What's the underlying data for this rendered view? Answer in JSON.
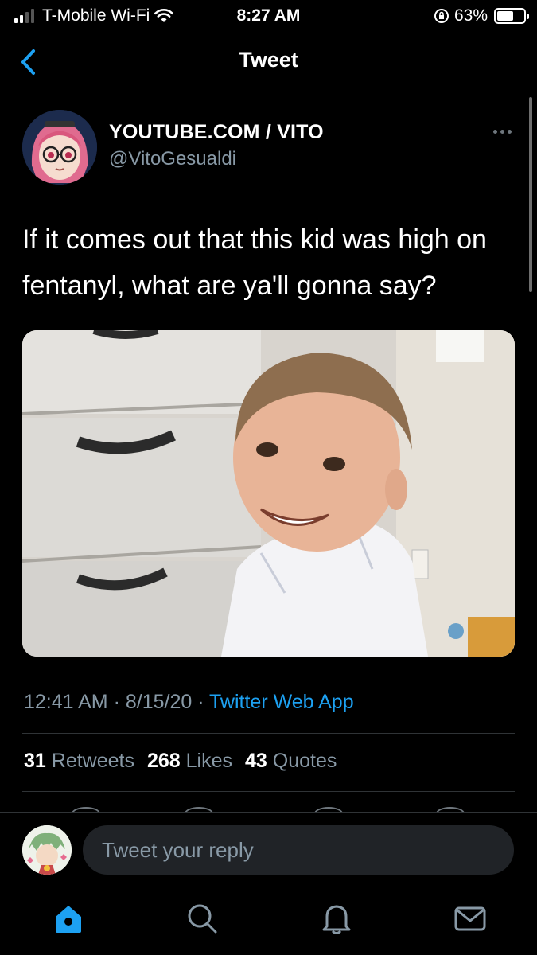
{
  "status_bar": {
    "carrier": "T-Mobile Wi-Fi",
    "time": "8:27 AM",
    "battery": "63%",
    "battery_level": 0.63
  },
  "nav": {
    "title": "Tweet",
    "back_icon": "chevron-left-icon"
  },
  "tweet": {
    "display_name": "YOUTUBE.COM / VITO",
    "handle": "@VitoGesualdi",
    "text": "If it comes out that this kid was high on fentanyl, what are ya'll gonna say?",
    "timestamp": "12:41 AM · 8/15/20 · ",
    "source": "Twitter Web App",
    "stats": {
      "retweets_count": "31",
      "retweets_label": "Retweets",
      "likes_count": "268",
      "likes_label": "Likes",
      "quotes_count": "43",
      "quotes_label": "Quotes"
    }
  },
  "reply": {
    "placeholder": "Tweet your reply"
  },
  "tabs": [
    "home-icon",
    "search-icon",
    "notifications-icon",
    "messages-icon"
  ],
  "colors": {
    "accent": "#1da1f2",
    "secondary_text": "#8899a6",
    "background": "#000000"
  }
}
